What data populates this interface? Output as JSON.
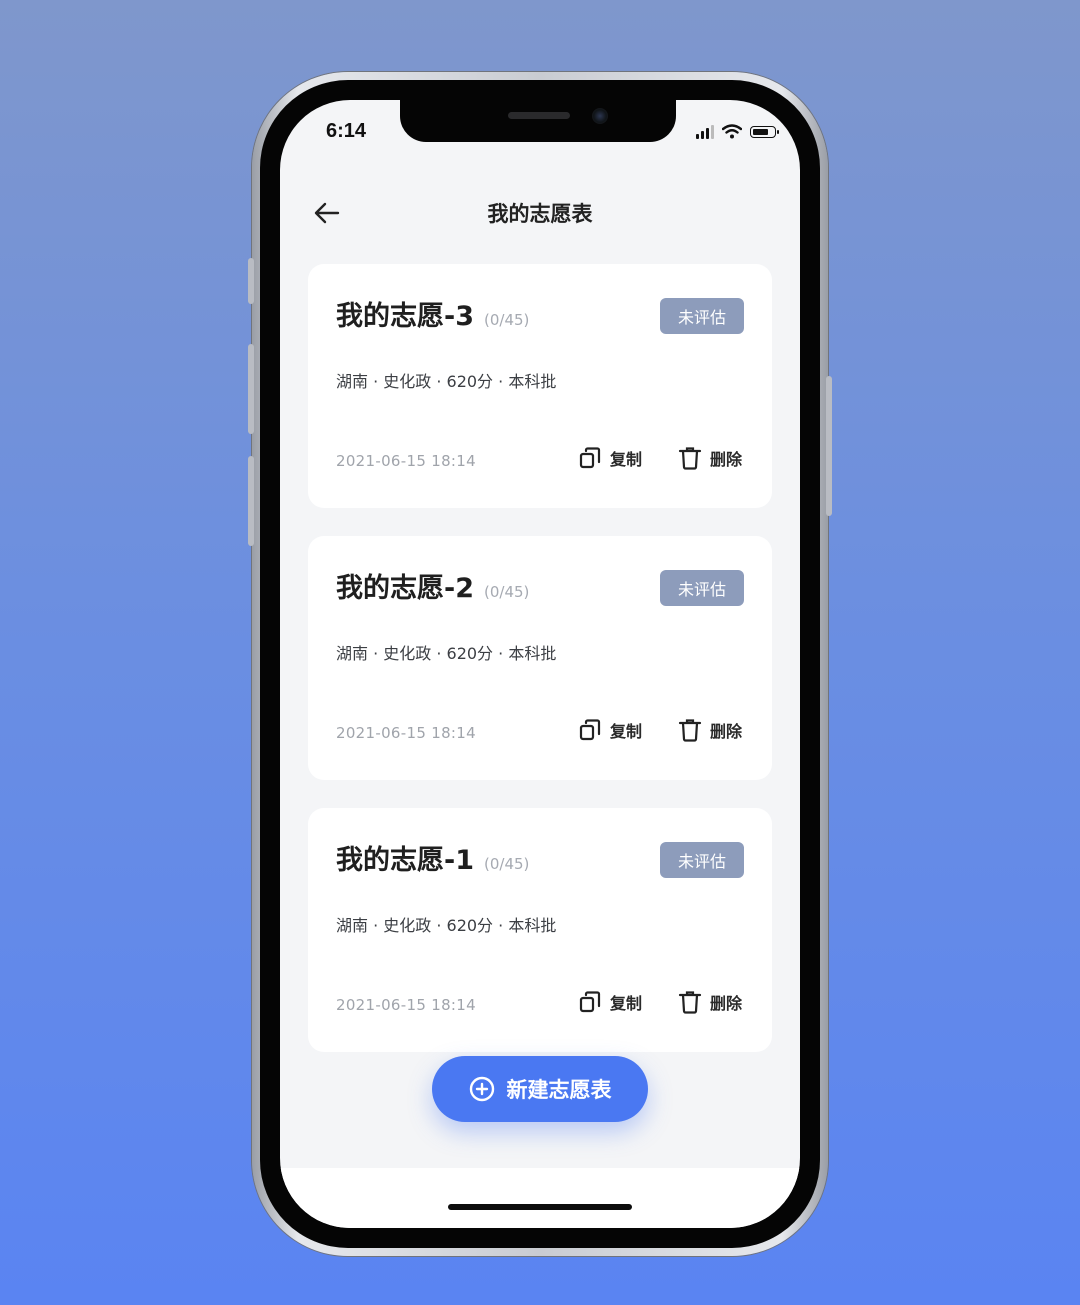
{
  "status_bar": {
    "time": "6:14"
  },
  "header": {
    "title": "我的志愿表"
  },
  "cards": [
    {
      "title": "我的志愿-3",
      "count": "(0/45)",
      "badge": "未评估",
      "meta": "湖南 · 史化政 · 620分 · 本科批",
      "date": "2021-06-15 18:14",
      "copy_label": "复制",
      "delete_label": "删除"
    },
    {
      "title": "我的志愿-2",
      "count": "(0/45)",
      "badge": "未评估",
      "meta": "湖南 · 史化政 · 620分 · 本科批",
      "date": "2021-06-15 18:14",
      "copy_label": "复制",
      "delete_label": "删除"
    },
    {
      "title": "我的志愿-1",
      "count": "(0/45)",
      "badge": "未评估",
      "meta": "湖南 · 史化政 · 620分 · 本科批",
      "date": "2021-06-15 18:14",
      "copy_label": "复制",
      "delete_label": "删除"
    }
  ],
  "fab": {
    "label": "新建志愿表"
  },
  "icons": {
    "back": "arrow-left-icon",
    "copy": "copy-icon",
    "delete": "trash-icon",
    "add": "plus-circle-icon"
  },
  "colors": {
    "accent": "#4a78f2",
    "badge": "#8d9cbb",
    "background": "#f4f5f7"
  }
}
